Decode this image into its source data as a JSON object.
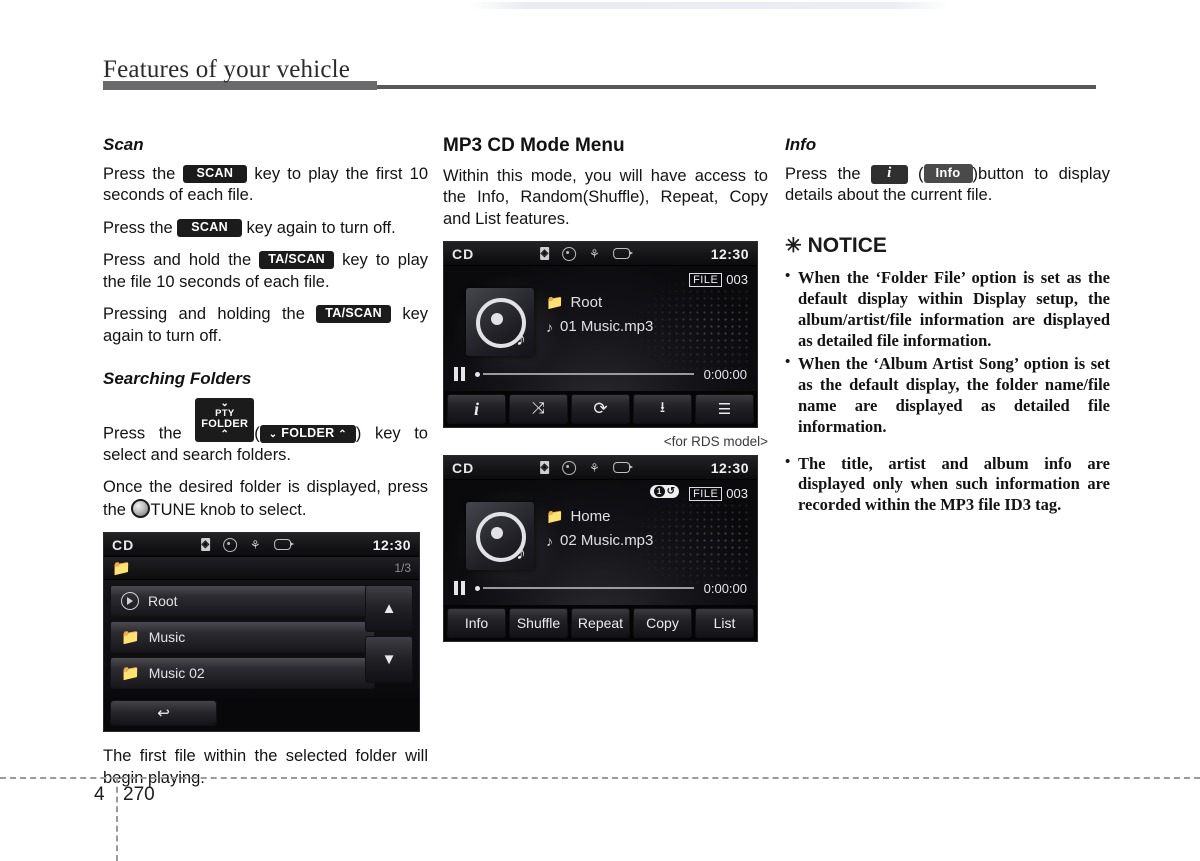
{
  "header": {
    "title": "Features of your vehicle",
    "ghost_text": ""
  },
  "left_column": {
    "scan": {
      "heading": "Scan",
      "p1_a": "Press the",
      "p1_key": "SCAN",
      "p1_b": "key to play the first 10 seconds of each file.",
      "p2_a": "Press the",
      "p2_key": "SCAN",
      "p2_b": "key again to turn off.",
      "p3_a": "Press and hold the",
      "p3_key": "TA/SCAN",
      "p3_b": "key to play the file 10 seconds of each file.",
      "p4_a": "Pressing and holding the",
      "p4_key": "TA/SCAN",
      "p4_b": "key again to turn off."
    },
    "searching_folders": {
      "heading": "Searching Folders",
      "p1_a": "Press the",
      "key_line1": "PTY",
      "key_line2": "FOLDER",
      "key_alt": "FOLDER",
      "p1_b": "key to select and search folders.",
      "p2_a": "Once the desired folder is displayed, press the",
      "p2_knob": "TUNE",
      "p2_b": "knob to select."
    },
    "list_screen": {
      "source": "CD",
      "clock": "12:30",
      "page_indicator": "1/3",
      "rows": [
        {
          "icon": "play-icon",
          "label": "Root"
        },
        {
          "icon": "folder-icon",
          "label": "Music"
        },
        {
          "icon": "folder-icon",
          "label": "Music 02"
        }
      ],
      "up_arrow": "▲",
      "down_arrow": "▼",
      "back_icon": "↩"
    },
    "closing_text": "The first file within the selected folder will begin playing."
  },
  "middle_column": {
    "heading": "MP3 CD Mode Menu",
    "intro": "Within this mode, you will have access to the Info, Random(Shuffle), Repeat, Copy and List features.",
    "screen_rds": {
      "source": "CD",
      "clock": "12:30",
      "file_label": "FILE",
      "file_number": "003",
      "folder": "Root",
      "track": "01 Music.mp3",
      "time": "0:00:00",
      "buttons": [
        {
          "name": "info-button",
          "glyph": "i"
        },
        {
          "name": "shuffle-button",
          "glyph": "⤨"
        },
        {
          "name": "repeat-button",
          "glyph": "⟳"
        },
        {
          "name": "copy-button",
          "glyph": "⭳"
        },
        {
          "name": "list-button",
          "glyph": "☰"
        }
      ]
    },
    "caption": "<for RDS model>",
    "screen_std": {
      "source": "CD",
      "clock": "12:30",
      "file_label": "FILE",
      "file_number": "003",
      "repeat_badge": "1",
      "folder": "Home",
      "track": "02 Music.mp3",
      "time": "0:00:00",
      "buttons": [
        {
          "name": "info-button",
          "label": "Info"
        },
        {
          "name": "shuffle-button",
          "label": "Shuffle"
        },
        {
          "name": "repeat-button",
          "label": "Repeat"
        },
        {
          "name": "copy-button",
          "label": "Copy"
        },
        {
          "name": "list-button",
          "label": "List"
        }
      ]
    }
  },
  "right_column": {
    "info": {
      "heading": "Info",
      "p1_a": "Press the",
      "key_i": "i",
      "key_info": "Info",
      "p1_b": ")button to display details about the current file."
    },
    "notice": {
      "heading": "NOTICE",
      "star": "✳",
      "items": [
        "When the ‘Folder File’ option is set as the default display within Display setup, the album/artist/file information are displayed as detailed file information.",
        "When the ‘Album Artist Song’ option is set as the default display, the folder name/file name are displayed as detailed file information.",
        "The title, artist and album info are displayed only when such information are recorded within the MP3 file ID3 tag."
      ]
    }
  },
  "footer": {
    "chapter": "4",
    "page": "270"
  }
}
